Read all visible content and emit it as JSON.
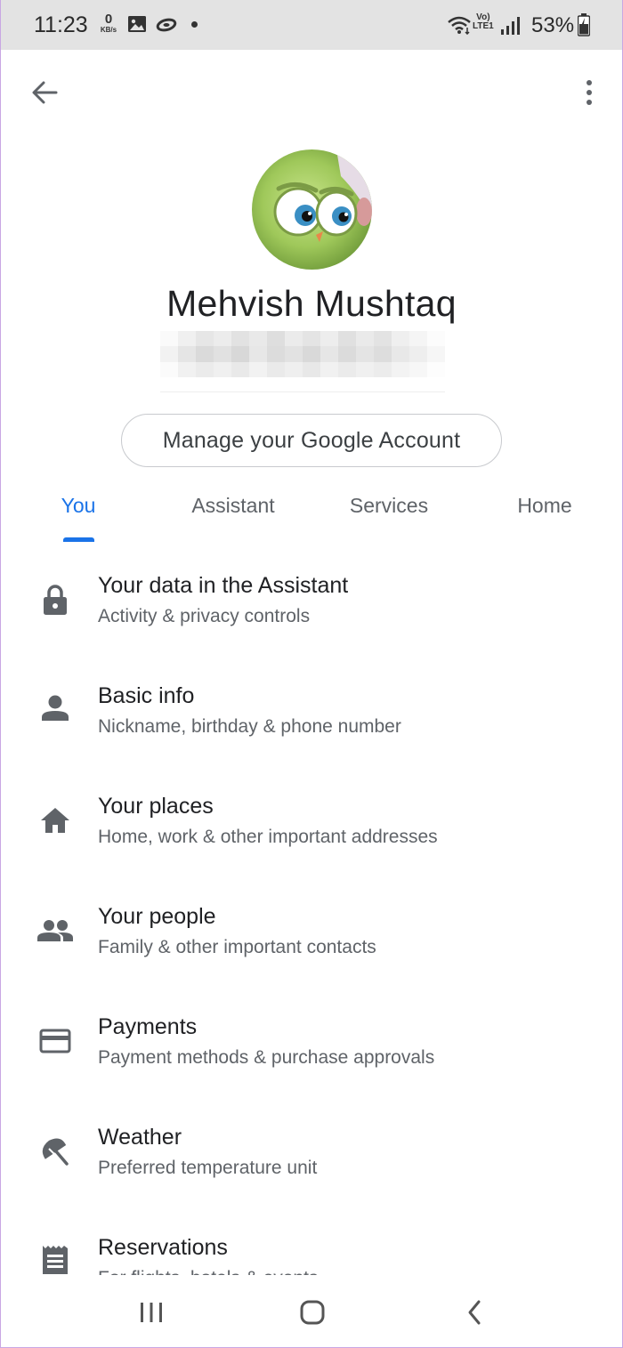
{
  "status_bar": {
    "time": "11:23",
    "net_speed_value": "0",
    "net_speed_unit": "KB/s",
    "volte_label": "Vo)",
    "lte_label": "LTE1",
    "battery_percent": "53%"
  },
  "profile": {
    "name": "Mehvish Mushtaq",
    "manage_button_label": "Manage your Google Account"
  },
  "tabs": [
    {
      "label": "You",
      "active": true
    },
    {
      "label": "Assistant",
      "active": false
    },
    {
      "label": "Services",
      "active": false
    },
    {
      "label": "Home",
      "active": false
    }
  ],
  "settings_items": [
    {
      "title": "Your data in the Assistant",
      "subtitle": "Activity & privacy controls",
      "icon": "lock-icon"
    },
    {
      "title": "Basic info",
      "subtitle": "Nickname, birthday & phone number",
      "icon": "person-icon"
    },
    {
      "title": "Your places",
      "subtitle": "Home, work & other important addresses",
      "icon": "home-icon"
    },
    {
      "title": "Your people",
      "subtitle": "Family & other important contacts",
      "icon": "people-icon"
    },
    {
      "title": "Payments",
      "subtitle": "Payment methods & purchase approvals",
      "icon": "credit-card-icon"
    },
    {
      "title": "Weather",
      "subtitle": "Preferred temperature unit",
      "icon": "umbrella-icon"
    },
    {
      "title": "Reservations",
      "subtitle": "For flights, hotels & events",
      "icon": "receipt-icon"
    }
  ],
  "colors": {
    "accent": "#1a73e8",
    "icon_gray": "#5f6368",
    "status_bar_bg": "#e3e3e3"
  }
}
